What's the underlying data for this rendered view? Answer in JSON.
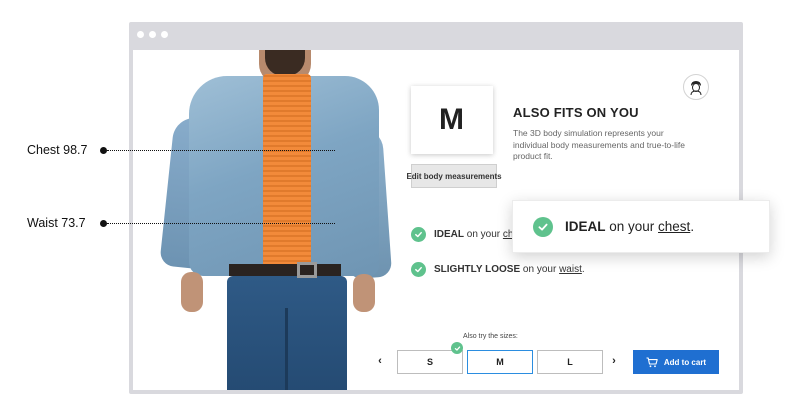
{
  "annotations": {
    "chest_label": "Chest 98.7",
    "waist_label": "Waist 73.7"
  },
  "product": {
    "selected_size": "M",
    "fits_title": "ALSO FITS ON YOU",
    "fits_description": "The 3D body simulation represents your individual body measurements and true-to-life product fit.",
    "edit_button": "Edit body measurements"
  },
  "fit_results": {
    "chest": {
      "verdict": "IDEAL",
      "middle": " on your ",
      "part": "chest",
      "end": "."
    },
    "waist": {
      "verdict": "SLIGHTLY LOOSE",
      "middle": " on your ",
      "part": "waist",
      "end": "."
    }
  },
  "callout": {
    "verdict": "IDEAL",
    "middle": " on your ",
    "part": "chest",
    "end": "."
  },
  "sizes": {
    "label": "Also try the sizes:",
    "options": [
      "S",
      "M",
      "L"
    ],
    "active": "M",
    "prev_arrow": "‹",
    "next_arrow": "›"
  },
  "cart": {
    "label": "Add to cart"
  },
  "colors": {
    "accent_blue": "#1f6fd1",
    "success_green": "#5fc28d",
    "active_border": "#2b8de0"
  },
  "icons": [
    "avatar-icon",
    "checkmark-icon",
    "cart-icon",
    "chevron-left-icon",
    "chevron-right-icon"
  ]
}
